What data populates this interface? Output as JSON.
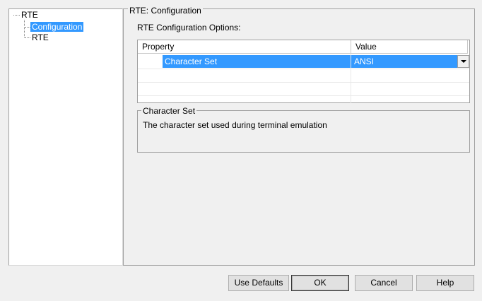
{
  "tree": {
    "root_label": "RTE",
    "children": [
      "Configuration",
      "RTE"
    ]
  },
  "panel": {
    "title": "RTE: Configuration",
    "options_label": "RTE Configuration Options:"
  },
  "grid": {
    "headers": [
      "Property",
      "Value"
    ],
    "rows": [
      {
        "property": "Character Set",
        "value": "ANSI",
        "selected": true
      }
    ]
  },
  "description": {
    "title": "Character Set",
    "text": "The character set used during terminal emulation"
  },
  "buttons": {
    "use_defaults": "Use Defaults",
    "ok": "OK",
    "cancel": "Cancel",
    "help": "Help"
  },
  "colors": {
    "selection": "#3399ff",
    "window_bg": "#f0f0f0"
  }
}
